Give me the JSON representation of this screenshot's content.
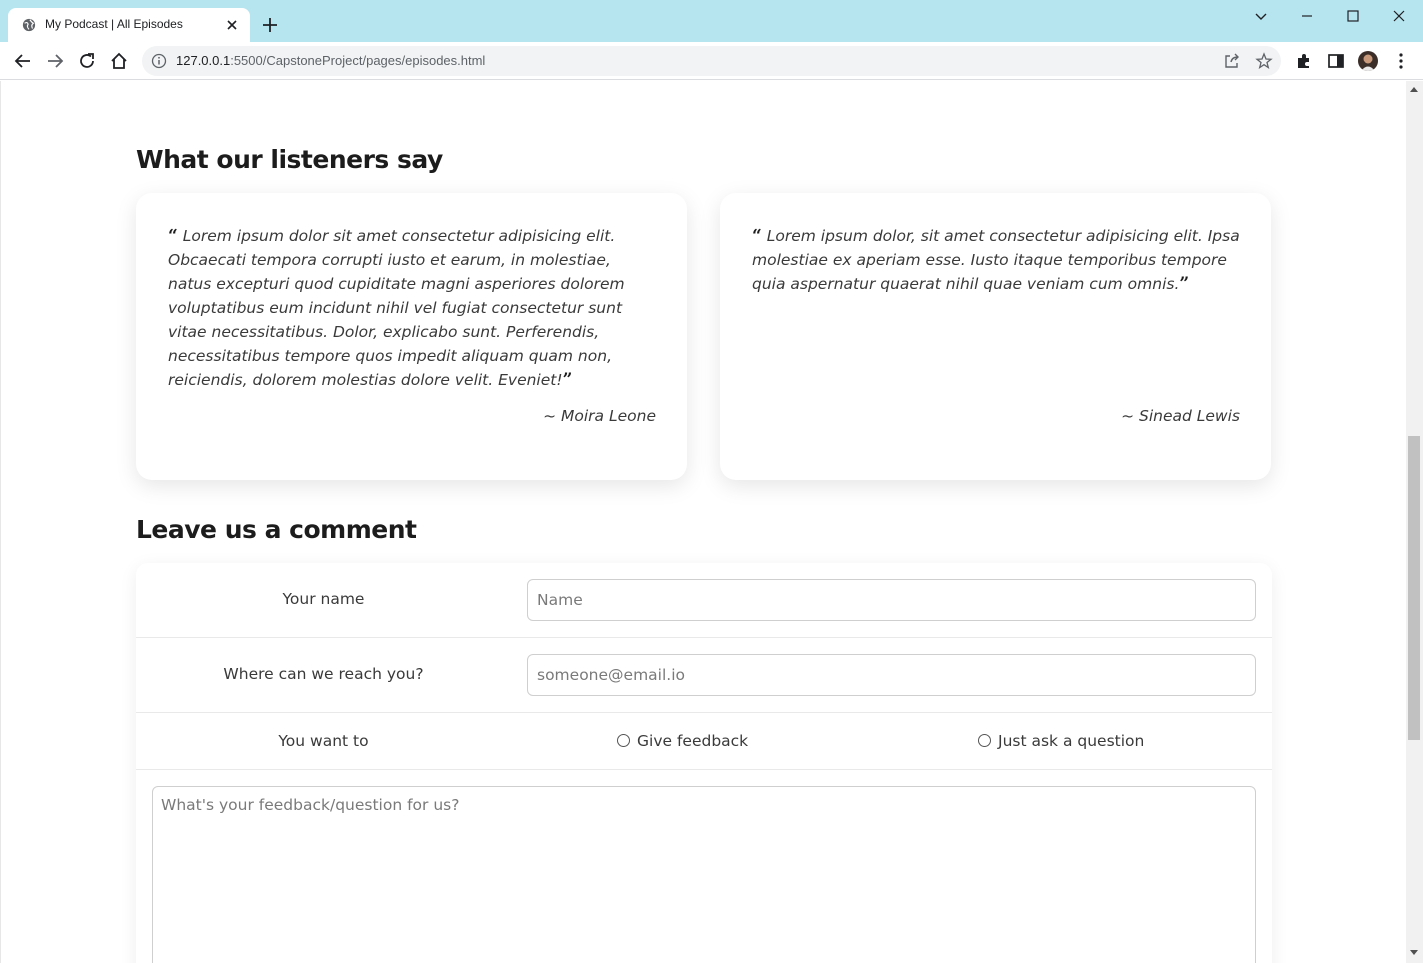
{
  "browser": {
    "tab_title": "My Podcast | All Episodes",
    "url_host": "127.0.0.1",
    "url_rest": ":5500/CapstoneProject/pages/episodes.html"
  },
  "testimonials": {
    "heading": "What our listeners say",
    "items": [
      {
        "quote": "Lorem ipsum dolor sit amet consectetur adipisicing elit. Obcaecati tempora corrupti iusto et earum, in molestiae, natus excepturi quod cupiditate magni asperiores dolorem voluptatibus eum incidunt nihil vel fugiat consectetur sunt vitae necessitatibus. Dolor, explicabo sunt. Perferendis, necessitatibus tempore quos impedit aliquam quam non, reiciendis, dolorem molestias dolore velit. Eveniet!",
        "author": "~ Moira Leone"
      },
      {
        "quote": "Lorem ipsum dolor, sit amet consectetur adipisicing elit. Ipsa molestiae ex aperiam esse. Iusto itaque temporibus tempore quia aspernatur quaerat nihil quae veniam cum omnis.",
        "author": "~ Sinead Lewis"
      }
    ]
  },
  "comment_form": {
    "heading": "Leave us a comment",
    "name_label": "Your name",
    "name_placeholder": "Name",
    "email_label": "Where can we reach you?",
    "email_placeholder": "someone@email.io",
    "intent_label": "You want to",
    "options": [
      "Give feedback",
      "Just ask a question"
    ],
    "message_placeholder": "What's your feedback/question for us?"
  }
}
